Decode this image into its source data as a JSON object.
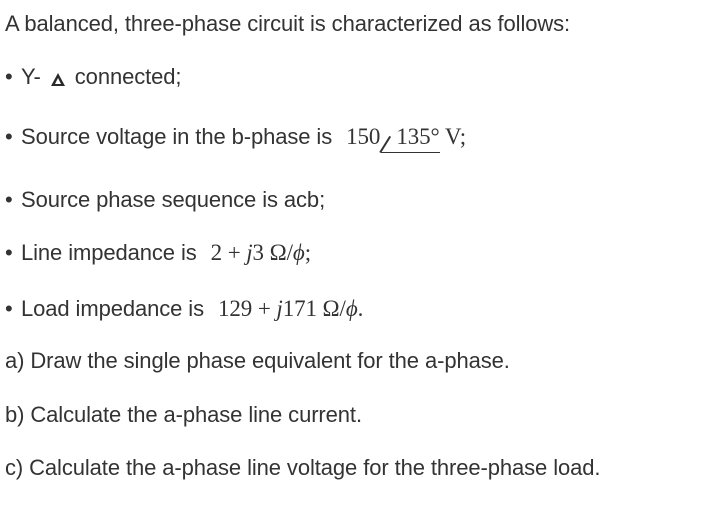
{
  "intro": "A balanced, three-phase circuit is characterized as follows:",
  "bullet_glyph": "•",
  "items": [
    {
      "prefix": "Y-",
      "icon": "delta-icon",
      "suffix": "connected;"
    },
    {
      "text": "Source voltage in the b-phase is",
      "magnitude": "150",
      "angle": "135°",
      "unit": "V;"
    },
    {
      "text": "Source phase sequence is acb;"
    },
    {
      "text": "Line impedance is",
      "real": "2",
      "plus": "+",
      "j": "j",
      "imag": "3",
      "unit": "Ω/",
      "phi": "ϕ",
      "end": ";"
    },
    {
      "text": "Load impedance is",
      "real": "129",
      "plus": "+",
      "j": "j",
      "imag": "171",
      "unit": "Ω/",
      "phi": "ϕ",
      "end": "."
    }
  ],
  "questions": [
    "a) Draw the single phase equivalent for the a-phase.",
    "b) Calculate the a-phase line current.",
    "c) Calculate the a-phase line voltage for the three-phase load."
  ]
}
